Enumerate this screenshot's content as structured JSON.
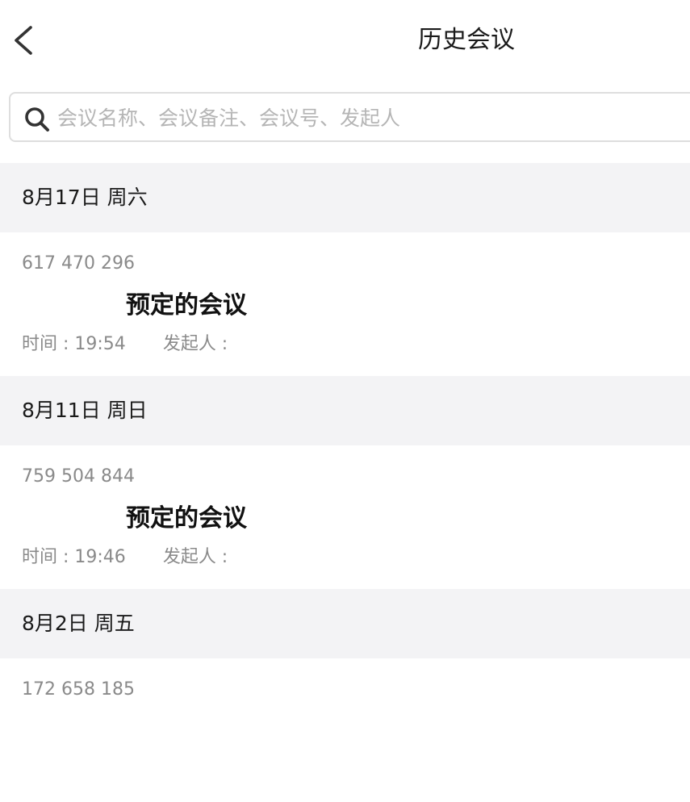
{
  "nav": {
    "title": "历史会议",
    "back_icon": "chevron-left-icon"
  },
  "search": {
    "icon": "search-icon",
    "placeholder": "会议名称、会议备注、会议号、发起人",
    "value": ""
  },
  "groups": [
    {
      "date": "8月17日 周六",
      "meetings": [
        {
          "number": "617 470 296",
          "title": "预定的会议",
          "time": "时间 : 19:54",
          "initiator": "发起人 :"
        }
      ]
    },
    {
      "date": "8月11日 周日",
      "meetings": [
        {
          "number": "759 504 844",
          "title": "预定的会议",
          "time": "时间 : 19:46",
          "initiator": "发起人 :"
        }
      ]
    },
    {
      "date": "8月2日 周五",
      "meetings": [
        {
          "number": "172 658 185",
          "title": "",
          "time": "",
          "initiator": ""
        }
      ]
    }
  ],
  "colors": {
    "background": "#ffffff",
    "section_header_bg": "#f3f3f5",
    "secondary_text": "#8a8a8a",
    "primary_text": "#1a1a1a"
  }
}
